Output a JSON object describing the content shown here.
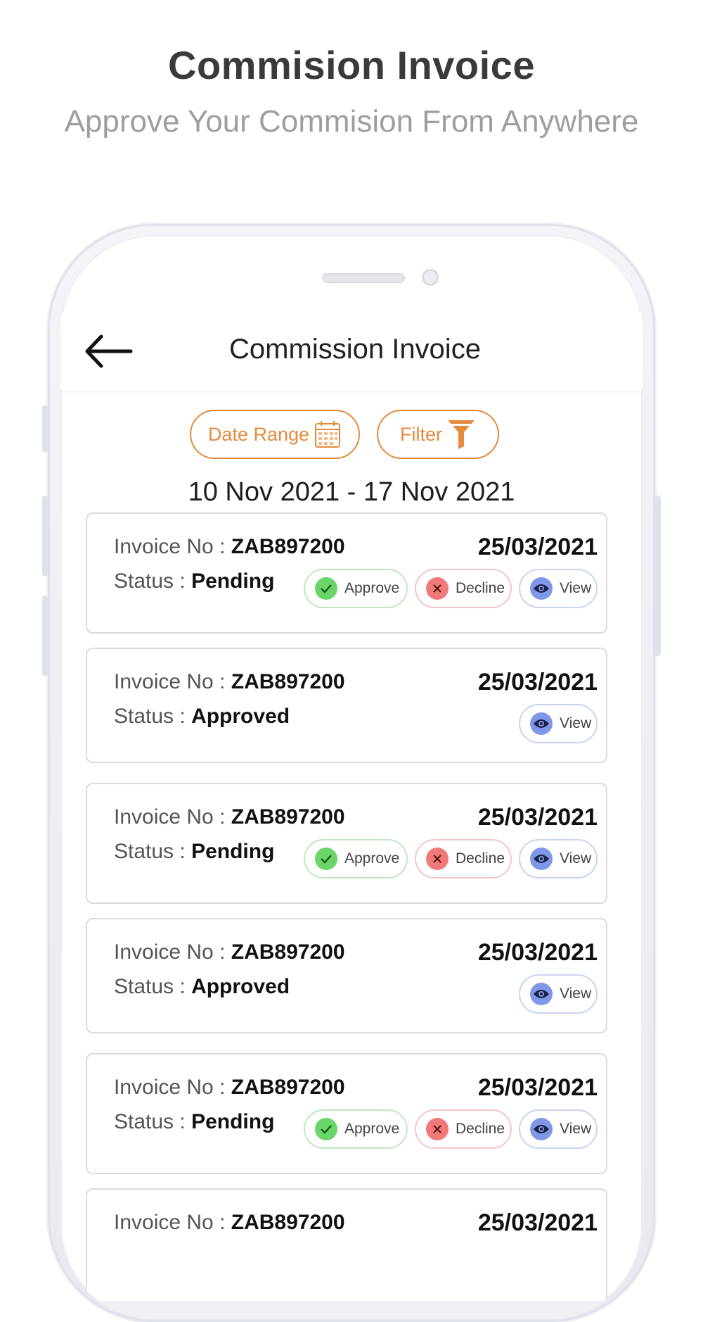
{
  "promo": {
    "title": "Commision Invoice",
    "subtitle": "Approve Your Commision From Anywhere"
  },
  "header": {
    "title": "Commission Invoice",
    "back_icon": "arrow-left-icon"
  },
  "toolbar": {
    "date_range_label": "Date Range",
    "date_range_icon": "calendar-icon",
    "filter_label": "Filter",
    "filter_icon": "funnel-icon",
    "accent_color": "#e58a3c"
  },
  "date_range_text": "10 Nov 2021 - 17 Nov 2021",
  "labels": {
    "invoice_no": "Invoice No : ",
    "status": "Status : ",
    "approve": "Approve",
    "decline": "Decline",
    "view": "View"
  },
  "invoices": [
    {
      "number": "ZAB897200",
      "date": "25/03/2021",
      "status": "Pending"
    },
    {
      "number": "ZAB897200",
      "date": "25/03/2021",
      "status": "Approved"
    },
    {
      "number": "ZAB897200",
      "date": "25/03/2021",
      "status": "Pending"
    },
    {
      "number": "ZAB897200",
      "date": "25/03/2021",
      "status": "Approved"
    },
    {
      "number": "ZAB897200",
      "date": "25/03/2021",
      "status": "Pending"
    },
    {
      "number": "ZAB897200",
      "date": "25/03/2021",
      "status": ""
    }
  ]
}
